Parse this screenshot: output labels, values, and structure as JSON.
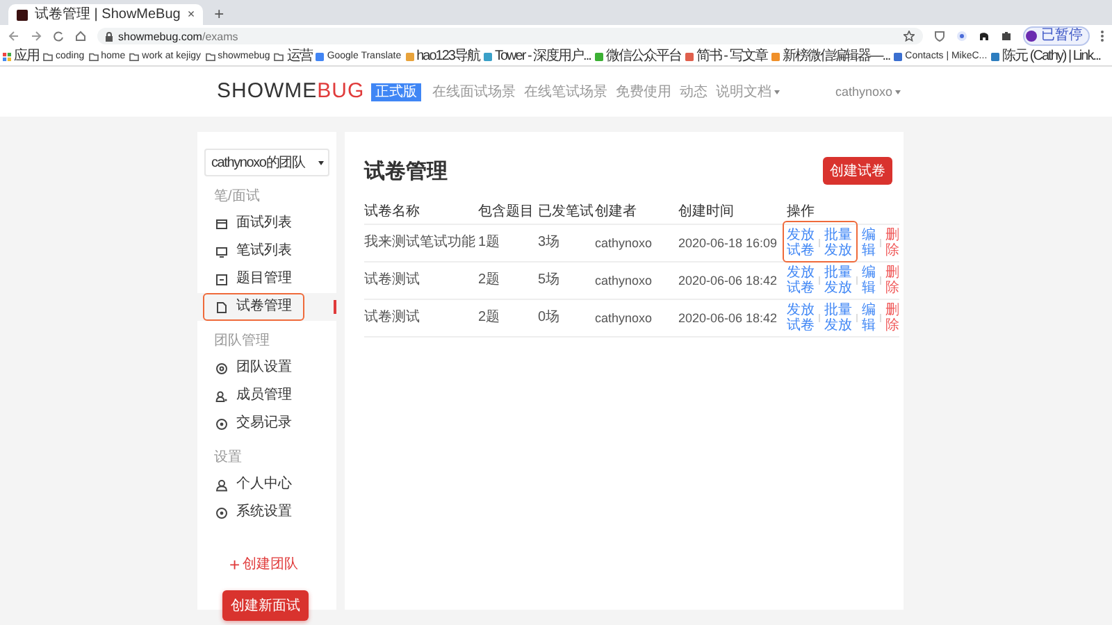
{
  "browser": {
    "tab_title": "试卷管理 | ShowMeBug",
    "tab_close": "×",
    "new_tab": "+",
    "url_host": "showmebug.com",
    "url_path": "/exams",
    "profile": "已暂停",
    "bookmarks": [
      {
        "label": "应用",
        "kind": "apps"
      },
      {
        "label": "coding",
        "kind": "folder"
      },
      {
        "label": "home",
        "kind": "folder"
      },
      {
        "label": "work at kejigy",
        "kind": "folder"
      },
      {
        "label": "showmebug",
        "kind": "folder"
      },
      {
        "label": "运营",
        "kind": "folder"
      },
      {
        "label": "Google Translate",
        "kind": "site",
        "color": "#4285f4"
      },
      {
        "label": "hao123导航",
        "kind": "site",
        "color": "#e8a33b"
      },
      {
        "label": "Tower - 深度用户...",
        "kind": "site",
        "color": "#3aa0c8"
      },
      {
        "label": "微信公众平台",
        "kind": "site",
        "color": "#3cb034"
      },
      {
        "label": "简书 - 写文章",
        "kind": "site",
        "color": "#e0604d"
      },
      {
        "label": "新榜微信编辑器—...",
        "kind": "site",
        "color": "#f0902a"
      },
      {
        "label": "Contacts | MikeC...",
        "kind": "site",
        "color": "#3b6fd0"
      },
      {
        "label": "陈元 (Cathy) | Link...",
        "kind": "site",
        "color": "#2d7dbf"
      }
    ]
  },
  "header": {
    "logo_main": "SHOWME",
    "logo_accent": "BUG",
    "badge": "正式版",
    "nav": [
      {
        "label": "在线面试场景",
        "dropdown": false
      },
      {
        "label": "在线笔试场景",
        "dropdown": false
      },
      {
        "label": "免费使用",
        "dropdown": false
      },
      {
        "label": "动态",
        "dropdown": false
      },
      {
        "label": "说明文档",
        "dropdown": true
      }
    ],
    "user": "cathynoxo"
  },
  "sidebar": {
    "team": "cathynoxo的团队",
    "sections": [
      {
        "title": "笔/面试",
        "items": [
          {
            "label": "面试列表",
            "selected": false,
            "highlighted": false
          },
          {
            "label": "笔试列表",
            "selected": false,
            "highlighted": false
          },
          {
            "label": "题目管理",
            "selected": false,
            "highlighted": false
          },
          {
            "label": "试卷管理",
            "selected": true,
            "highlighted": true
          }
        ]
      },
      {
        "title": "团队管理",
        "items": [
          {
            "label": "团队设置",
            "selected": false,
            "highlighted": false
          },
          {
            "label": "成员管理",
            "selected": false,
            "highlighted": false
          },
          {
            "label": "交易记录",
            "selected": false,
            "highlighted": false
          }
        ]
      },
      {
        "title": "设置",
        "items": [
          {
            "label": "个人中心",
            "selected": false,
            "highlighted": false
          },
          {
            "label": "系统设置",
            "selected": false,
            "highlighted": false
          }
        ]
      }
    ],
    "create_team": "创建团队",
    "create_team_icon": "+",
    "create_interview": "创建新面试"
  },
  "main": {
    "title": "试卷管理",
    "create_button": "创建试卷",
    "columns": [
      "试卷名称",
      "包含题目",
      "已发笔试",
      "创建者",
      "创建时间",
      "操作"
    ],
    "rows": [
      {
        "cells": [
          "我来测试笔试功能",
          "1题",
          "3场",
          "cathynoxo",
          "2020-06-18 16:09"
        ],
        "highlighted": true,
        "actions": [
          {
            "label": "发放试卷",
            "kind": "link"
          },
          {
            "label": "批量发放",
            "kind": "link"
          },
          {
            "label": "编辑",
            "kind": "link"
          },
          {
            "label": "删除",
            "kind": "danger"
          }
        ]
      },
      {
        "cells": [
          "试卷测试",
          "2题",
          "5场",
          "cathynoxo",
          "2020-06-06 18:42"
        ],
        "highlighted": false,
        "actions": [
          {
            "label": "发放试卷",
            "kind": "link"
          },
          {
            "label": "批量发放",
            "kind": "link"
          },
          {
            "label": "编辑",
            "kind": "link"
          },
          {
            "label": "删除",
            "kind": "danger"
          }
        ]
      },
      {
        "cells": [
          "试卷测试",
          "2题",
          "0场",
          "cathynoxo",
          "2020-06-06 18:42"
        ],
        "highlighted": false,
        "actions": [
          {
            "label": "发放试卷",
            "kind": "link"
          },
          {
            "label": "批量发放",
            "kind": "link"
          },
          {
            "label": "编辑",
            "kind": "link"
          },
          {
            "label": "删除",
            "kind": "danger"
          }
        ]
      }
    ]
  }
}
